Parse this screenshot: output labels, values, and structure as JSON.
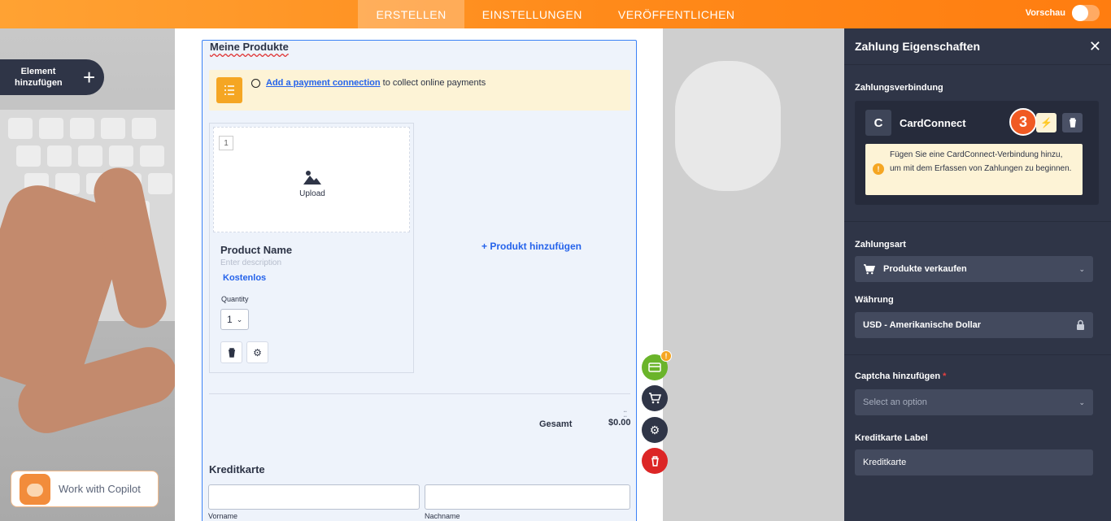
{
  "topbar": {
    "tabs": [
      {
        "label": "ERSTELLEN",
        "active": true
      },
      {
        "label": "EINSTELLUNGEN",
        "active": false
      },
      {
        "label": "VERÖFFENTLICHEN",
        "active": false
      }
    ],
    "preview_label": "Vorschau"
  },
  "add_element": {
    "label": "Element hinzufügen",
    "icon": "plus-icon"
  },
  "form": {
    "field_title": "Meine Produkte",
    "notice": {
      "link": "Add a payment connection",
      "text": " to collect online payments"
    },
    "product": {
      "number": "1",
      "upload": "Upload",
      "name": "Product Name",
      "description": "Enter description",
      "price": "Kostenlos",
      "quantity_label": "Quantity",
      "quantity_value": "1"
    },
    "add_product": "+ Produkt hinzufügen",
    "total_label": "Gesamt",
    "total_value": "$0.00",
    "card_title": "Kreditkarte",
    "first_name_label": "Vorname",
    "last_name_label": "Nachname"
  },
  "fabs": {
    "badge": "!"
  },
  "copilot": {
    "label": "Work with Copilot"
  },
  "panel": {
    "title": "Zahlung Eigenschaften",
    "connection_label": "Zahlungsverbindung",
    "connection_logo": "C",
    "connection_name": "CardConnect",
    "step": "3",
    "warning": "Fügen Sie eine CardConnect-Verbindung hinzu, um mit dem Erfassen von Zahlungen zu beginnen.",
    "payment_type_label": "Zahlungsart",
    "payment_type_value": "Produkte verkaufen",
    "currency_label": "Währung",
    "currency_value": "USD - Amerikanische Dollar",
    "captcha_label": "Captcha hinzufügen",
    "captcha_required": "*",
    "captcha_placeholder": "Select an option",
    "cc_label_label": "Kreditkarte Label",
    "cc_label_value": "Kreditkarte"
  },
  "colors": {
    "accent": "#ff8a1a",
    "panel_bg": "#2f3547",
    "link": "#2563eb",
    "warning_bg": "#fdf3d6"
  }
}
